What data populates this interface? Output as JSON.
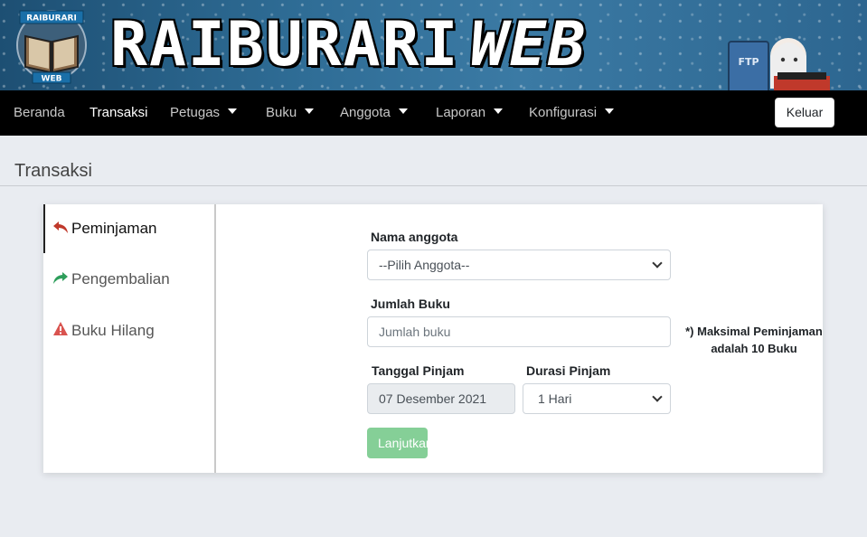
{
  "banner": {
    "logo_top_text": "RAIBURARI",
    "logo_bottom_text": "WEB",
    "title_part1": "RAIBURARI",
    "title_part2": "WEB",
    "mascot_book_text": "FTP"
  },
  "nav": {
    "items": [
      {
        "label": "Beranda",
        "dropdown": false,
        "active": false
      },
      {
        "label": "Transaksi",
        "dropdown": false,
        "active": true
      },
      {
        "label": "Petugas",
        "dropdown": true,
        "active": false
      },
      {
        "label": "Buku",
        "dropdown": true,
        "active": false
      },
      {
        "label": "Anggota",
        "dropdown": true,
        "active": false
      },
      {
        "label": "Laporan",
        "dropdown": true,
        "active": false
      },
      {
        "label": "Konfigurasi",
        "dropdown": true,
        "active": false
      }
    ],
    "logout_label": "Keluar"
  },
  "page": {
    "title": "Transaksi"
  },
  "sidebar": {
    "items": [
      {
        "label": "Peminjaman",
        "icon": "reply-arrow-icon",
        "color": "#c0392b"
      },
      {
        "label": "Pengembalian",
        "icon": "share-arrow-icon",
        "color": "#2e9e5b"
      },
      {
        "label": "Buku Hilang",
        "icon": "warning-triangle-icon",
        "color": "#d9534f"
      }
    ]
  },
  "form": {
    "member_label": "Nama anggota",
    "member_selected": "--Pilih Anggota--",
    "qty_label": "Jumlah Buku",
    "qty_placeholder": "Jumlah buku",
    "qty_value": "",
    "qty_note_line1": "*) Maksimal Peminjaman",
    "qty_note_line2": "adalah 10 Buku",
    "date_label": "Tanggal Pinjam",
    "date_value": "07 Desember 2021",
    "duration_label": "Durasi Pinjam",
    "duration_selected": "1 Hari",
    "submit_label": "Lanjutkan"
  },
  "colors": {
    "navbar_bg": "#000000",
    "submit_bg": "#85cf97",
    "page_bg": "#e9ecf1"
  }
}
